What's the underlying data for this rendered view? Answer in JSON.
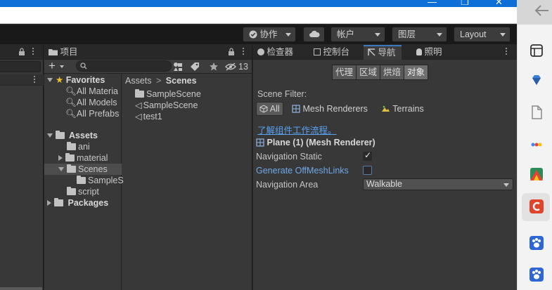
{
  "toolbar": {
    "collab": "协作",
    "account": "帐户",
    "layers": "图层",
    "layout": "Layout"
  },
  "project": {
    "tab": "项目",
    "hidden_count": "13",
    "search_placeholder": "",
    "favorites": {
      "title": "Favorites",
      "items": [
        "All Materia",
        "All Models",
        "All Prefabs"
      ]
    },
    "assets": {
      "title": "Assets",
      "items": [
        "ani",
        "material",
        "Scenes",
        "SampleS",
        "script"
      ]
    },
    "packages": "Packages",
    "breadcrumb": {
      "root": "Assets",
      "sep": ">",
      "current": "Scenes"
    },
    "files": [
      "SampleScene",
      "SampleScene",
      "test1"
    ]
  },
  "tabs": {
    "inspector": "检查器",
    "console": "控制台",
    "navigation": "导航",
    "lighting": "照明"
  },
  "navigation": {
    "segments": [
      "代理",
      "区域",
      "烘焙",
      "对象"
    ],
    "active_segment": "对象",
    "scene_filter_label": "Scene Filter:",
    "filters": [
      "All",
      "Mesh Renderers",
      "Terrains"
    ],
    "active_filter": "All",
    "learn_link": "了解组件工作流程。",
    "object_title": "Plane (1) (Mesh Renderer)",
    "nav_static_label": "Navigation Static",
    "nav_static_checked": true,
    "offmesh_label": "Generate OffMeshLinks",
    "offmesh_checked": false,
    "nav_area_label": "Navigation Area",
    "nav_area_value": "Walkable"
  },
  "colors": {
    "accent_blue": "#3a79bb",
    "link": "#5aa1f0",
    "title_bar": "#0d6fd8",
    "dock_red": "#e0452b"
  }
}
